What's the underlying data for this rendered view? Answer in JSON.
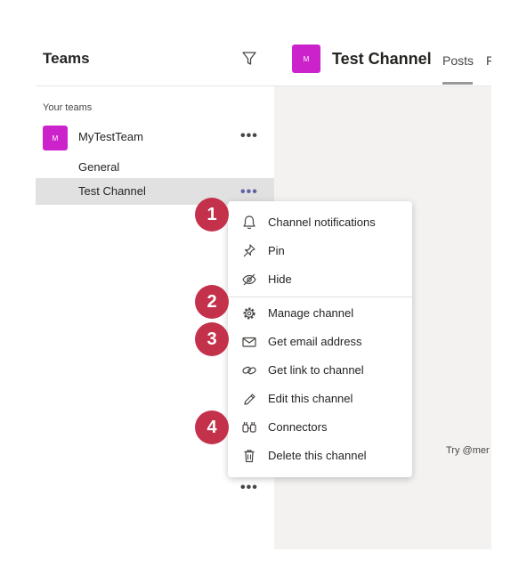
{
  "sidebar": {
    "title": "Teams",
    "section_label": "Your teams",
    "team": {
      "avatar_initial": "M",
      "name": "MyTestTeam",
      "more": "•••"
    },
    "channels": [
      {
        "label": "General"
      },
      {
        "label": "Test Channel",
        "more": "•••"
      }
    ],
    "bottom_more": "•••"
  },
  "channel_header": {
    "avatar_initial": "M",
    "title": "Test Channel",
    "tabs": [
      {
        "label": "Posts"
      },
      {
        "label": "F"
      }
    ]
  },
  "body_hint": "Try @mer",
  "context_menu": {
    "items": [
      {
        "label": "Channel notifications",
        "icon": "bell-icon"
      },
      {
        "label": "Pin",
        "icon": "pin-icon"
      },
      {
        "label": "Hide",
        "icon": "eye-off-icon"
      },
      {
        "label": "Manage channel",
        "icon": "gear-icon"
      },
      {
        "label": "Get email address",
        "icon": "mail-icon"
      },
      {
        "label": "Get link to channel",
        "icon": "link-icon"
      },
      {
        "label": "Edit this channel",
        "icon": "pencil-icon"
      },
      {
        "label": "Connectors",
        "icon": "connectors-icon"
      },
      {
        "label": "Delete this channel",
        "icon": "trash-icon"
      }
    ]
  },
  "annotations": [
    "1",
    "2",
    "3",
    "4"
  ],
  "colors": {
    "accent_magenta": "#cc22cc",
    "badge_red": "#c4314b",
    "selected_row": "#e1e1e1",
    "channel_background": "#f3f2f1"
  }
}
